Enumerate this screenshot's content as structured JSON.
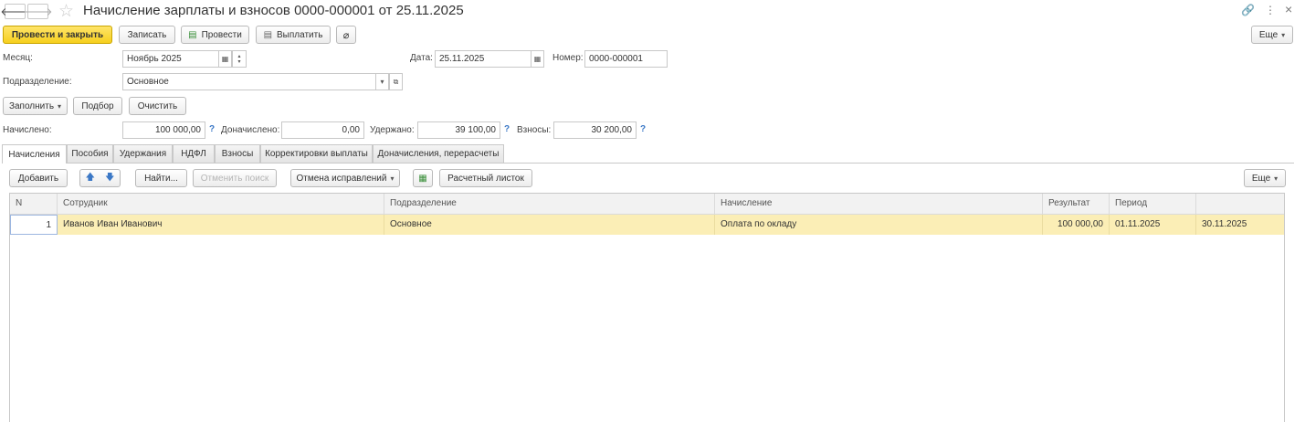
{
  "window": {
    "title": "Начисление зарплаты и взносов 0000-000001 от 25.11.2025",
    "back_glyph": "🡐",
    "forward_glyph": "🡒",
    "star_glyph": "☆",
    "link_glyph": "🔗",
    "menu_glyph": "⋮",
    "close_glyph": "×"
  },
  "toolbar": {
    "post_and_close": "Провести и закрыть",
    "save": "Записать",
    "post": "Провести",
    "pay": "Выплатить",
    "more": "Еще"
  },
  "form": {
    "month_label": "Месяц:",
    "month_value": "Ноябрь 2025",
    "date_label": "Дата:",
    "date_value": "25.11.2025",
    "number_label": "Номер:",
    "number_value": "0000-000001",
    "department_label": "Подразделение:",
    "department_value": "Основное",
    "fill_button": "Заполнить",
    "pick_button": "Подбор",
    "clear_button": "Очистить"
  },
  "totals": {
    "accrued_label": "Начислено:",
    "accrued_value": "100 000,00",
    "additional_label": "Доначислено:",
    "additional_value": "0,00",
    "withheld_label": "Удержано:",
    "withheld_value": "39 100,00",
    "contributions_label": "Взносы:",
    "contributions_value": "30 200,00",
    "help_glyph": "?"
  },
  "tabs": [
    {
      "label": "Начисления"
    },
    {
      "label": "Пособия"
    },
    {
      "label": "Удержания"
    },
    {
      "label": "НДФЛ"
    },
    {
      "label": "Взносы"
    },
    {
      "label": "Корректировки выплаты"
    },
    {
      "label": "Доначисления, перерасчеты"
    }
  ],
  "table_toolbar": {
    "add": "Добавить",
    "up_glyph": "🡅",
    "down_glyph": "🡇",
    "find": "Найти...",
    "cancel_search": "Отменить поиск",
    "cancel_corrections": "Отмена исправлений",
    "payslip": "Расчетный листок",
    "more": "Еще"
  },
  "table": {
    "columns": [
      "N",
      "Сотрудник",
      "Подразделение",
      "Начисление",
      "Результат",
      "Период",
      ""
    ],
    "rows": [
      [
        "1",
        "Иванов Иван Иванович",
        "Основное",
        "Оплата по окладу",
        "100 000,00",
        "01.11.2025",
        "30.11.2025"
      ]
    ]
  },
  "colors": {
    "primary_button": "#f6cf1e",
    "selected_row": "#fbeeb6",
    "help": "#3b78c6"
  }
}
